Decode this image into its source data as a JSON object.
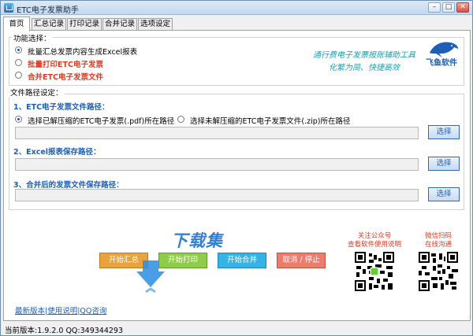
{
  "window": {
    "title": "ETC电子发票助手"
  },
  "tabs": [
    "首页",
    "汇总记录",
    "打印记录",
    "合并记录",
    "选项设定"
  ],
  "func_section": {
    "legend": "功能选择：",
    "options": [
      {
        "label": "批量汇总发票内容生成Excel报表",
        "selected": true
      },
      {
        "label": "批量打印ETC电子发票",
        "selected": false
      },
      {
        "label": "合并ETC电子发票文件",
        "selected": false
      }
    ],
    "slogan_line1": "通行费电子发票报账辅助工具",
    "slogan_line2": "化繁为简、快捷高效",
    "brand": "飞鱼软件"
  },
  "path_section": {
    "legend": "文件路径设定：",
    "pdf_heading": "1、ETC电子发票文件路径：",
    "radio_unzipped": "选择已解压缩的ETC电子发票(.pdf)所在路径",
    "radio_zip": "选择未解压缩的ETC电子发票文件(.zip)所在路径",
    "excel_heading": "2、Excel报表保存路径：",
    "merge_heading": "3、合并后的发票文件保存路径：",
    "pick_label": "选择"
  },
  "actions": {
    "summarize": "开始汇总",
    "print": "开始打印",
    "merge": "开始合并",
    "cancel": "取消 / 停止"
  },
  "watermark": {
    "text": "下载集"
  },
  "qr": {
    "left_line1": "关注公众号",
    "left_line2": "查看软件使用说明",
    "right_line1": "微信扫码",
    "right_line2": "在线沟通"
  },
  "links": "最新版本|使用说明|QQ咨询",
  "statusbar": {
    "text": "当前版本:1.9.2.0    QQ:349344293"
  },
  "colors": {
    "accent": "#1d5fb6",
    "red": "#e03a20",
    "teal": "#16a3b4"
  }
}
